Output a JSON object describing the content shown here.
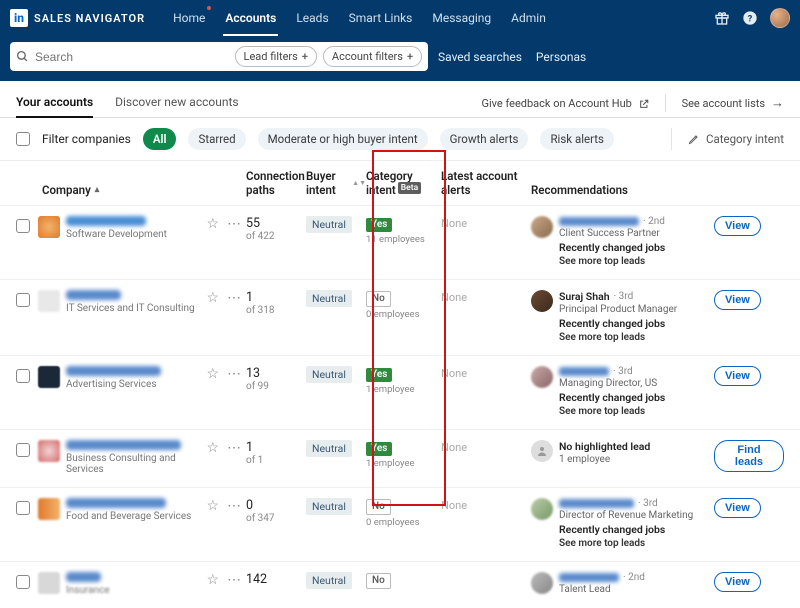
{
  "brand": "SALES NAVIGATOR",
  "nav": {
    "home": "Home",
    "accounts": "Accounts",
    "leads": "Leads",
    "smart_links": "Smart Links",
    "messaging": "Messaging",
    "admin": "Admin"
  },
  "search": {
    "placeholder": "Search",
    "lead_filters": "Lead filters",
    "account_filters": "Account filters",
    "saved": "Saved searches",
    "personas": "Personas"
  },
  "tabs": {
    "your": "Your accounts",
    "discover": "Discover new accounts",
    "feedback": "Give feedback on Account Hub",
    "lists": "See account lists"
  },
  "filters": {
    "label": "Filter companies",
    "all": "All",
    "starred": "Starred",
    "moderate": "Moderate or high buyer intent",
    "growth": "Growth alerts",
    "risk": "Risk alerts",
    "category_intent_action": "Category intent"
  },
  "headers": {
    "company": "Company",
    "connection": "Connection paths",
    "buyer": "Buyer intent",
    "category": "Category intent",
    "beta": "Beta",
    "alerts": "Latest account alerts",
    "rec": "Recommendations"
  },
  "common": {
    "none": "None",
    "neutral": "Neutral",
    "view": "View",
    "find_leads": "Find leads",
    "see_more": "See more top leads",
    "recently_changed": "Recently changed jobs",
    "no_highlighted": "No highlighted lead"
  },
  "rows": [
    {
      "industry": "Software Development",
      "conn": "55",
      "conn_of": "of 422",
      "cat": "Yes",
      "cat_sub": "11 employees",
      "rec_deg": "2nd",
      "rec_title": "Client Success Partner"
    },
    {
      "industry": "IT Services and IT Consulting",
      "conn": "1",
      "conn_of": "of 318",
      "cat": "No",
      "cat_sub": "0 employees",
      "rec_name": "Suraj Shah",
      "rec_deg": "3rd",
      "rec_title": "Principal Product Manager"
    },
    {
      "industry": "Advertising Services",
      "conn": "13",
      "conn_of": "of 99",
      "cat": "Yes",
      "cat_sub": "1 employee",
      "rec_deg": "3rd",
      "rec_title": "Managing Director, US"
    },
    {
      "industry": "Business Consulting and Services",
      "conn": "1",
      "conn_of": "of 1",
      "cat": "Yes",
      "cat_sub": "1 employee",
      "no_lead": true,
      "rec_title": "1 employee"
    },
    {
      "industry": "Food and Beverage Services",
      "conn": "0",
      "conn_of": "of 347",
      "cat": "No",
      "cat_sub": "0 employees",
      "rec_deg": "3rd",
      "rec_title": "Director of Revenue Marketing"
    },
    {
      "industry": "Insurance",
      "conn": "142",
      "conn_of": "",
      "cat": "No",
      "cat_sub": "",
      "rec_deg": "2nd",
      "rec_title": "Talent Lead"
    }
  ]
}
